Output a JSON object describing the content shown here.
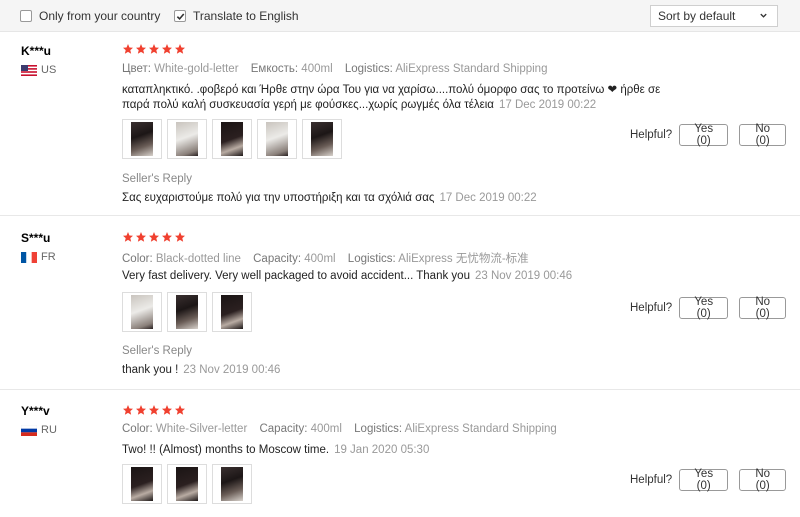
{
  "filters": {
    "only_country_label": "Only from your country",
    "only_country_checked": false,
    "translate_label": "Translate to English",
    "translate_checked": true
  },
  "sort": {
    "selected": "Sort by default"
  },
  "reviews": [
    {
      "user": "K***u",
      "country_code": "US",
      "rating": 5,
      "attr1_key": "Цвет:",
      "attr1_val": "White-gold-letter",
      "attr2_key": "Емкость:",
      "attr2_val": "400ml",
      "attr3_key": "Logistics:",
      "attr3_val": "AliExpress Standard Shipping",
      "text": "καταπληκτικό. .φοβερό και Ήρθε στην ώρα Του για να χαρίσω....πολύ όμορφο σας το προτείνω ❤ ήρθε σε παρά πολύ καλή συσκευασία γερή με φούσκες...χωρίς ρωγμές όλα τέλεια",
      "date": "17 Dec 2019 00:22",
      "photo_count": 5,
      "seller_reply_label": "Seller's Reply",
      "seller_reply": "Σας ευχαριστούμε πολύ για την υποστήριξη και τα σχόλιά σας",
      "seller_reply_date": "17 Dec 2019 00:22",
      "helpful_label": "Helpful?",
      "yes_label": "Yes (0)",
      "no_label": "No (0)"
    },
    {
      "user": "S***u",
      "country_code": "FR",
      "rating": 5,
      "attr1_key": "Color:",
      "attr1_val": "Black-dotted line",
      "attr2_key": "Capacity:",
      "attr2_val": "400ml",
      "attr3_key": "Logistics:",
      "attr3_val": "AliExpress 无忧物流-标准",
      "text": "Very fast delivery. Very well packaged to avoid accident... Thank you",
      "date": "23 Nov 2019 00:46",
      "photo_count": 3,
      "seller_reply_label": "Seller's Reply",
      "seller_reply": "thank you !",
      "seller_reply_date": "23 Nov 2019 00:46",
      "helpful_label": "Helpful?",
      "yes_label": "Yes (0)",
      "no_label": "No (0)"
    },
    {
      "user": "Y***v",
      "country_code": "RU",
      "rating": 5,
      "attr1_key": "Color:",
      "attr1_val": "White-Silver-letter",
      "attr2_key": "Capacity:",
      "attr2_val": "400ml",
      "attr3_key": "Logistics:",
      "attr3_val": "AliExpress Standard Shipping",
      "text": "Two! !! (Almost) months to Moscow time.",
      "date": "19 Jan 2020 05:30",
      "photo_count": 3,
      "helpful_label": "Helpful?",
      "yes_label": "Yes (0)",
      "no_label": "No (0)"
    }
  ],
  "colors": {
    "star": "#f0402f",
    "checkbox_check": "#333333"
  }
}
